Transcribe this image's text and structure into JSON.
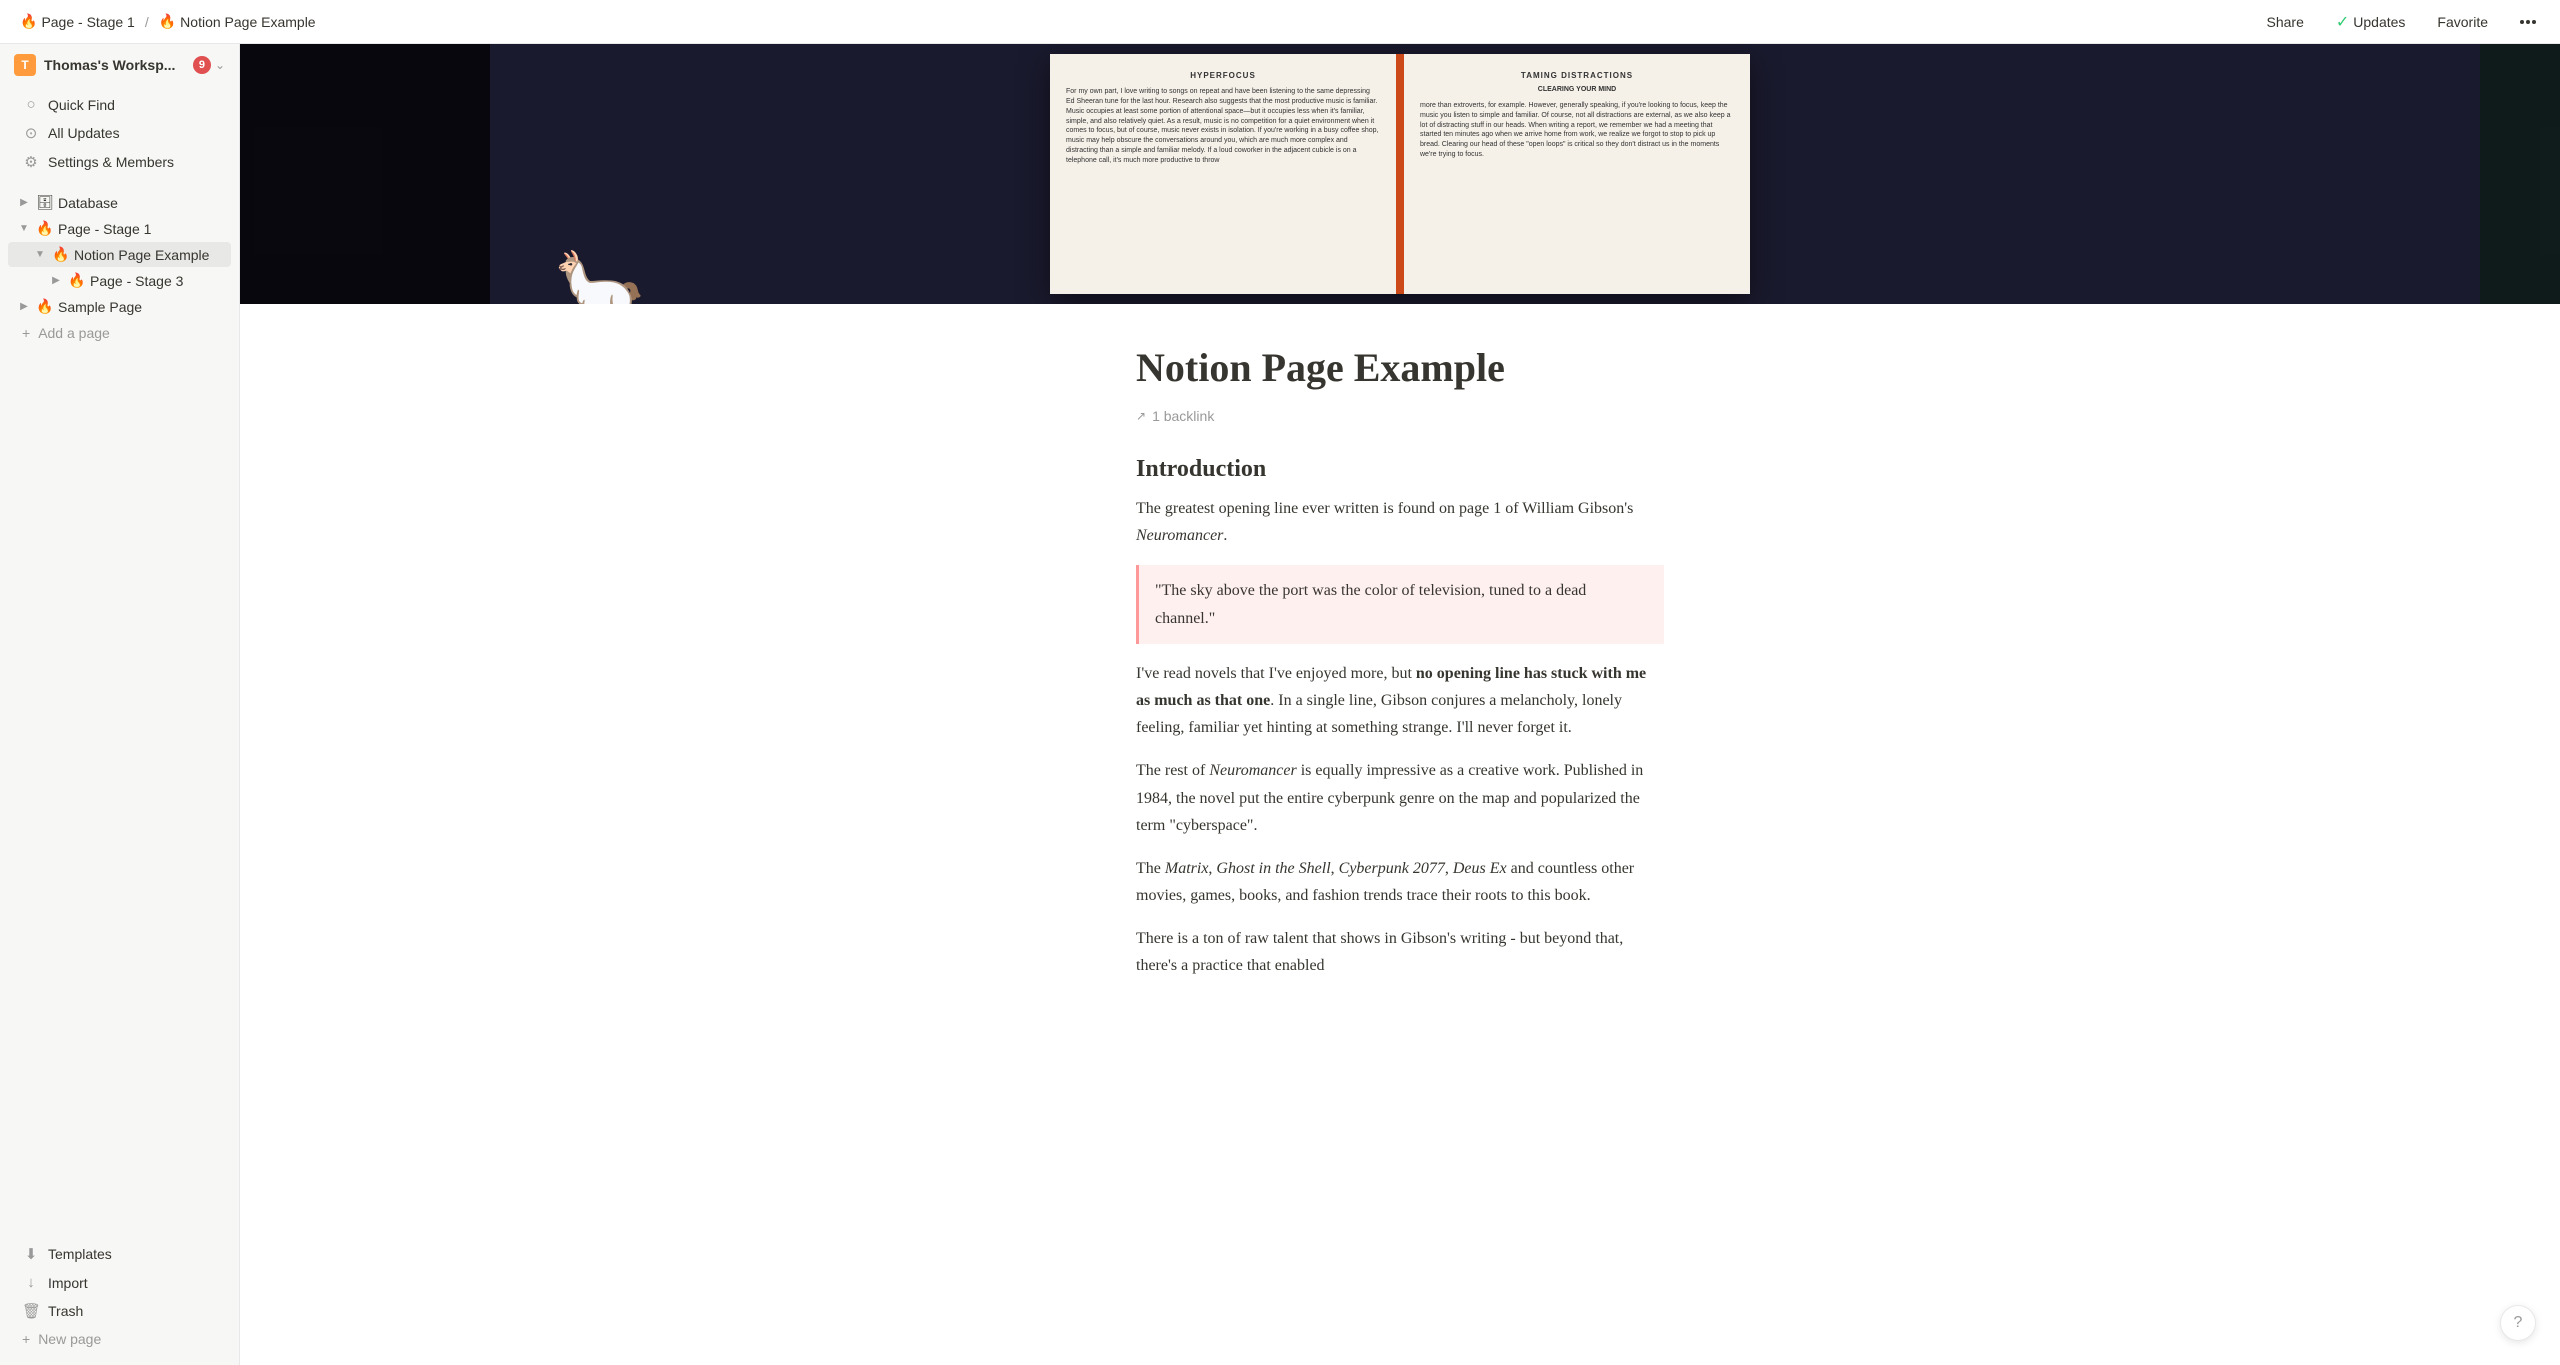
{
  "workspace": {
    "name": "Thomas's Worksp...",
    "badge": "9",
    "icon_letter": "T"
  },
  "topbar": {
    "breadcrumb": [
      {
        "label": "Page - Stage 1",
        "icon": "🔥"
      },
      {
        "label": "Notion Page Example",
        "icon": "🔥"
      }
    ],
    "share": "Share",
    "updates": "Updates",
    "favorite": "Favorite"
  },
  "sidebar": {
    "nav_items": [
      {
        "label": "Quick Find",
        "icon": "🔍"
      },
      {
        "label": "All Updates",
        "icon": "🕐"
      },
      {
        "label": "Settings & Members",
        "icon": "⚙️"
      }
    ],
    "tree": [
      {
        "label": "Database",
        "icon": "🗄️",
        "indent": 0,
        "toggle": "▶"
      },
      {
        "label": "Page - Stage 1",
        "icon": "🔥",
        "indent": 0,
        "toggle": "▼"
      },
      {
        "label": "Notion Page Example",
        "icon": "🔥",
        "indent": 1,
        "toggle": "▼",
        "active": true
      },
      {
        "label": "Page - Stage 3",
        "icon": "🔥",
        "indent": 2,
        "toggle": "▶"
      },
      {
        "label": "Sample Page",
        "icon": "🔥",
        "indent": 0,
        "toggle": "▶"
      }
    ],
    "add_page": "Add a page",
    "templates": "Templates",
    "import": "Import",
    "trash": "Trash",
    "new_page": "New page"
  },
  "page": {
    "title": "Notion Page Example",
    "backlink_count": "1 backlink",
    "intro_heading": "Introduction",
    "paragraph1": "The greatest opening line ever written is found on page 1 of William Gibson's Neuromancer.",
    "paragraph1_italic": "Neuromancer",
    "quote": "\"The sky above the port was the color of television, tuned to a dead channel.\"",
    "paragraph2_plain": "I've read novels that I've enjoyed more, but ",
    "paragraph2_bold": "no opening line has stuck with me as much as that one",
    "paragraph2_rest": ". In a single line, Gibson conjures a melancholy, lonely feeling, familiar yet hinting at something strange. I'll never forget it.",
    "paragraph3_plain": "The rest of ",
    "paragraph3_italic": "Neuromancer",
    "paragraph3_rest": " is equally impressive as a creative work. Published in 1984, the novel put the entire cyberpunk genre on the map and popularized the term \"cyberspace\".",
    "paragraph4_plain": "The ",
    "paragraph4_italic_parts": [
      "Matrix",
      "Ghost in the Shell",
      "Cyberpunk 2077",
      "Deus Ex"
    ],
    "paragraph4_rest": " and countless other movies, games, books, and fashion trends trace their roots to this book.",
    "paragraph5": "There is a ton of raw talent that shows in Gibson's writing - but beyond that, there's a practice that enabled"
  },
  "book": {
    "left_header": "HYPERFOCUS",
    "left_text": "For my own part, I love writing to songs on repeat and have been listening to the same depressing Ed Sheeran tune for the last hour. Research also suggests that the most productive music is familiar. Music occupies at least some portion of attentional space—but it occupies less when it's familiar, simple, and also relatively quiet. As a result, music is no competition for a quiet environment when it comes to focus, but of course, music never exists in isolation. If you're working in a busy coffee shop, music may help obscure the conversations around you, which are much more complex and distracting than a simple and familiar melody. If a loud coworker in the adjacent cubicle is on a telephone call, it's much more productive to throw",
    "right_header": "TAMING DISTRACTIONS",
    "right_subtitle": "CLEARING YOUR MIND",
    "right_text": "more than extroverts, for example. However, generally speaking, if you're looking to focus, keep the music you listen to simple and familiar. Of course, not all distractions are external, as we also keep a lot of distracting stuff in our heads. When writing a report, we remember we had a meeting that started ten minutes ago when we arrive home from work, we realize we forgot to stop to pick up bread. Clearing our head of these \"open loops\" is critical so they don't distract us in the moments we're trying to focus."
  },
  "help_button": "?"
}
